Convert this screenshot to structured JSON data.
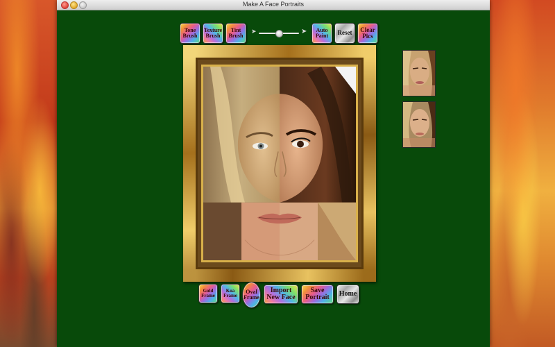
{
  "window": {
    "title": "Make A Face Portraits"
  },
  "toolbar": {
    "tone_brush": [
      "Tone",
      "Brush"
    ],
    "texture_brush": [
      "Texture",
      "Brush"
    ],
    "tint_brush": [
      "Tint",
      "Brush"
    ],
    "brush_size_slider": {
      "value": 0.5
    },
    "auto_paint": [
      "Auto",
      "Paint"
    ],
    "reset": "Reset",
    "clear_pics": [
      "Clear",
      "Pics"
    ]
  },
  "bottom_bar": {
    "gold_frame": [
      "Gold",
      "Frame"
    ],
    "koa_frame": [
      "Koa",
      "Frame"
    ],
    "oval_frame": [
      "Oval",
      "Frame"
    ],
    "import_new_face": [
      "Import",
      "New Face"
    ],
    "save_portrait": [
      "Save",
      "Portrait"
    ],
    "home": "Home"
  },
  "icons": {
    "slider_min": "small-arrow-icon",
    "slider_max": "large-arrow-icon"
  },
  "colors": {
    "window_bg": "#084a0a",
    "gold": "#c79a34"
  }
}
